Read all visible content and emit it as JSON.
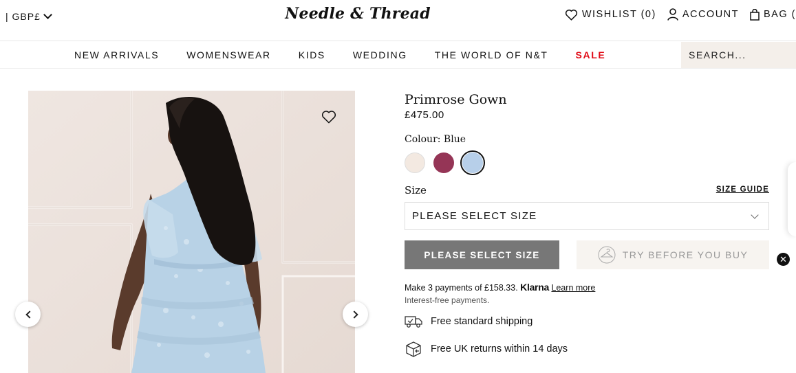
{
  "header": {
    "currency": "| GBP£",
    "logo": "Needle & Thread",
    "wishlist": "WISHLIST (0)",
    "account": "ACCOUNT",
    "bag": "BAG ("
  },
  "nav": {
    "items": [
      "NEW ARRIVALS",
      "WOMENSWEAR",
      "KIDS",
      "WEDDING",
      "THE WORLD OF N&T",
      "SALE"
    ],
    "search_placeholder": "SEARCH..."
  },
  "product": {
    "title": "Primrose Gown",
    "price": "£475.00",
    "colour_label": "Colour: Blue",
    "swatches": [
      {
        "name": "cream",
        "color": "#f3e9e1"
      },
      {
        "name": "berry",
        "color": "#953556"
      },
      {
        "name": "blue",
        "color": "#b7cfe9",
        "selected": true
      }
    ],
    "size_label": "Size",
    "size_guide": "SIZE GUIDE",
    "size_select": "PLEASE SELECT SIZE",
    "add_button": "PLEASE SELECT SIZE",
    "try_button": "TRY BEFORE YOU BUY",
    "klarna_text": "Make 3 payments of £158.33.",
    "klarna_brand": "Klarna",
    "klarna_learn": "Learn more",
    "klarna_sub": "Interest-free payments.",
    "perks": [
      "Free standard shipping",
      "Free UK returns within 14 days"
    ]
  },
  "colors": {
    "sale": "#e10b17",
    "search_bg": "#f4efea",
    "primary_button": "#777777",
    "dress": "#b8d2e6"
  }
}
